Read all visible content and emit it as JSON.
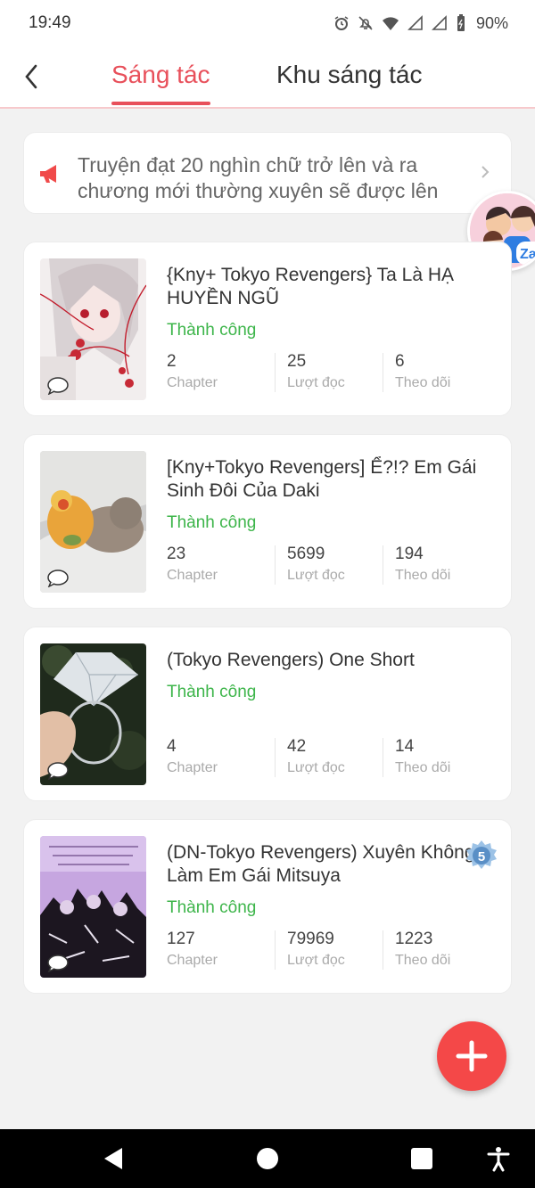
{
  "status_bar": {
    "time": "19:49",
    "battery": "90%"
  },
  "header": {
    "back_icon": "chevron-left-icon",
    "tabs": [
      {
        "label": "Sáng tác",
        "active": true
      },
      {
        "label": "Khu sáng tác",
        "active": false
      }
    ]
  },
  "notice": {
    "icon": "megaphone-icon",
    "text": "Truyện đạt 20 nghìn chữ trở lên và ra chương mới thường xuyên sẽ được lên"
  },
  "stories": [
    {
      "title": "{Kny+ Tokyo Revengers} Ta Là HẠ HUYỀN NGŨ",
      "status": "Thành công",
      "stats": [
        {
          "value": "2",
          "label": "Chapter"
        },
        {
          "value": "25",
          "label": "Lượt đọc"
        },
        {
          "value": "6",
          "label": "Theo dõi"
        }
      ]
    },
    {
      "title": "[Kny+Tokyo Revengers] Ể?!? Em Gái Sinh Đôi Của Daki",
      "status": "Thành công",
      "stats": [
        {
          "value": "23",
          "label": "Chapter"
        },
        {
          "value": "5699",
          "label": "Lượt đọc"
        },
        {
          "value": "194",
          "label": "Theo dõi"
        }
      ]
    },
    {
      "title": "(Tokyo Revengers) One Short",
      "status": "Thành công",
      "stats": [
        {
          "value": "4",
          "label": "Chapter"
        },
        {
          "value": "42",
          "label": "Lượt đọc"
        },
        {
          "value": "14",
          "label": "Theo dõi"
        }
      ]
    },
    {
      "title": "(DN-Tokyo Revengers) Xuyên Không Làm Em Gái Mitsuya",
      "status": "Thành công",
      "stats": [
        {
          "value": "127",
          "label": "Chapter"
        },
        {
          "value": "79969",
          "label": "Lượt đọc"
        },
        {
          "value": "1223",
          "label": "Theo dõi"
        }
      ],
      "badge": "5"
    }
  ],
  "floating": {
    "label": "Zal"
  },
  "colors": {
    "accent": "#e8505b",
    "success": "#3db54a",
    "fab": "#f44848"
  }
}
